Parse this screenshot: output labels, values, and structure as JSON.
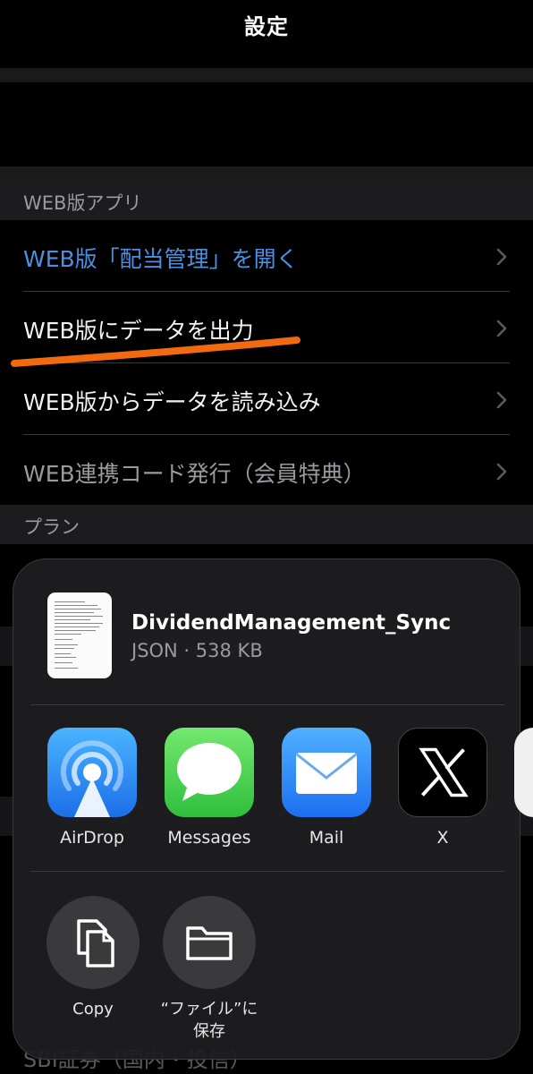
{
  "header": {
    "title": "設定"
  },
  "sections": {
    "web_app": {
      "header": "WEB版アプリ",
      "rows": [
        {
          "label": "WEB版「配当管理」を開く"
        },
        {
          "label": "WEB版にデータを出力"
        },
        {
          "label": "WEB版からデータを読み込み"
        },
        {
          "label": "WEB連携コード発行（会員特典）"
        }
      ]
    },
    "plan": {
      "header": "プラン"
    }
  },
  "background_partial": {
    "bottom_text": "SBI証券（国内・投信）"
  },
  "share_sheet": {
    "file": {
      "name": "DividendManagement_Sync",
      "meta": "JSON · 538 KB"
    },
    "apps": [
      {
        "name": "AirDrop",
        "icon": "airdrop-icon"
      },
      {
        "name": "Messages",
        "icon": "messages-icon"
      },
      {
        "name": "Mail",
        "icon": "mail-icon"
      },
      {
        "name": "X",
        "icon": "x-logo-icon"
      }
    ],
    "actions": [
      {
        "name": "Copy",
        "icon": "copy-icon"
      },
      {
        "name_line1": "“ファイル”に",
        "name_line2": "保存",
        "icon": "folder-icon"
      }
    ]
  },
  "colors": {
    "link_blue": "#4a90e2",
    "annotation_orange": "#f26a10",
    "background": "#000000"
  }
}
